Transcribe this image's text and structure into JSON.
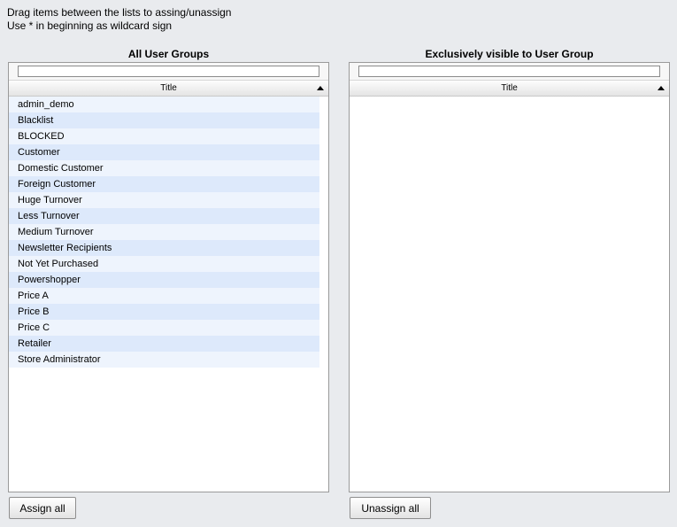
{
  "instructions": {
    "line1": "Drag items between the lists to assing/unassign",
    "line2": "Use * in beginning as wildcard sign"
  },
  "left_panel": {
    "title": "All User Groups",
    "filter_value": "",
    "column_header": "Title",
    "sort_icon": "sort-ascending-triangle",
    "items": [
      "admin_demo",
      "Blacklist",
      "BLOCKED",
      "Customer",
      "Domestic Customer",
      "Foreign Customer",
      "Huge Turnover",
      "Less Turnover",
      "Medium Turnover",
      "Newsletter Recipients",
      "Not Yet Purchased",
      "Powershopper",
      "Price A",
      "Price B",
      "Price C",
      "Retailer",
      "Store Administrator"
    ],
    "button_label": "Assign all"
  },
  "right_panel": {
    "title": "Exclusively visible to User Group",
    "filter_value": "",
    "column_header": "Title",
    "sort_icon": "sort-ascending-triangle",
    "items": [],
    "button_label": "Unassign all"
  },
  "colors": {
    "background": "#e9ebee",
    "row_odd": "#eef4fd",
    "row_even": "#dde9fb"
  }
}
